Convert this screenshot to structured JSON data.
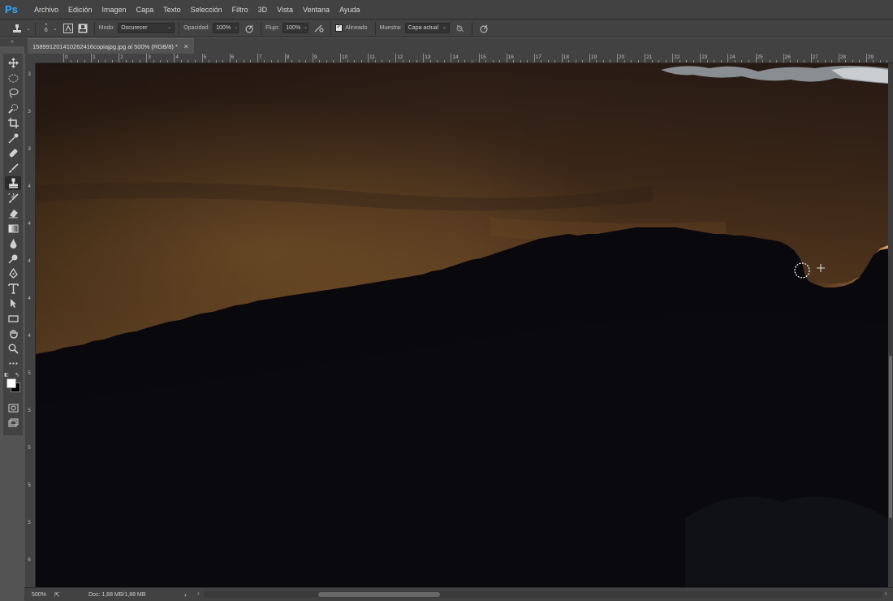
{
  "app": {
    "logo": "Ps"
  },
  "menu": [
    "Archivo",
    "Edición",
    "Imagen",
    "Capa",
    "Texto",
    "Selección",
    "Filtro",
    "3D",
    "Vista",
    "Ventana",
    "Ayuda"
  ],
  "options": {
    "brush_size": "6",
    "mode_label": "Modo:",
    "mode_value": "Oscurecer",
    "opacity_label": "Opacidad:",
    "opacity_value": "100%",
    "flow_label": "Flujo:",
    "flow_value": "100%",
    "aligned_label": "Alineado",
    "aligned_checked": true,
    "sample_label": "Muestra:",
    "sample_value": "Capa actual"
  },
  "document": {
    "tab_title": "158991201410262416copiajpg.jpg al 500% (RGB/8) *",
    "close": "✕"
  },
  "rulers": {
    "horizontal": [
      "0",
      "1",
      "2",
      "3",
      "4",
      "5",
      "6",
      "7",
      "8",
      "9",
      "10",
      "11",
      "12",
      "13",
      "14",
      "15",
      "16",
      "17",
      "18",
      "19",
      "20",
      "21",
      "22",
      "23",
      "24",
      "25",
      "26",
      "27",
      "28",
      "29"
    ],
    "vertical": [
      "3",
      "3",
      "3",
      "4",
      "4",
      "4",
      "4",
      "4",
      "5",
      "5",
      "5",
      "5",
      "5",
      "6"
    ]
  },
  "status": {
    "zoom": "500%",
    "doc_info": "Doc: 1,88 MB/1,88 MB",
    "arrow": "›"
  },
  "colors": {
    "foreground": "#ffffff",
    "background": "#000000",
    "ui_dark": "#424242",
    "ui_mid": "#535353",
    "accent_ps": "#31a8ff"
  },
  "tools": [
    "move-icon",
    "marquee-icon",
    "lasso-icon",
    "quick-selection-icon",
    "crop-icon",
    "eyedropper-icon",
    "healing-brush-icon",
    "brush-icon",
    "clone-stamp-icon",
    "history-brush-icon",
    "eraser-icon",
    "gradient-icon",
    "blur-icon",
    "dodge-icon",
    "pen-icon",
    "type-icon",
    "path-selection-icon",
    "rectangle-icon",
    "hand-icon",
    "zoom-icon",
    "more-tools-icon"
  ]
}
